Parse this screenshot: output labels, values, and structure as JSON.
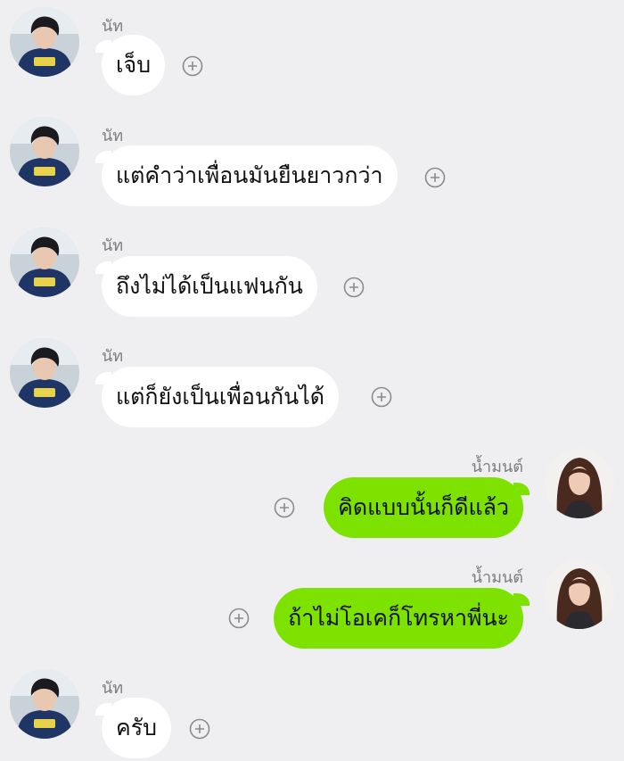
{
  "chat": {
    "messages": [
      {
        "sender": "นัท",
        "direction": "incoming",
        "text": "เจ็บ"
      },
      {
        "sender": "นัท",
        "direction": "incoming",
        "text": "แต่คำว่าเพื่อนมันยืนยาวกว่า"
      },
      {
        "sender": "นัท",
        "direction": "incoming",
        "text": "ถึงไม่ได้เป็นแฟนกัน"
      },
      {
        "sender": "นัท",
        "direction": "incoming",
        "text": "แต่ก็ยังเป็นเพื่อนกันได้"
      },
      {
        "sender": "น้ำมนต์",
        "direction": "outgoing",
        "text": "คิดแบบนั้นก็ดีแล้ว"
      },
      {
        "sender": "น้ำมนต์",
        "direction": "outgoing",
        "text": "ถ้าไม่โอเคก็โทรหาพี่นะ"
      },
      {
        "sender": "นัท",
        "direction": "incoming",
        "text": "ครับ"
      }
    ]
  },
  "icons": {
    "react": "plus-circle-icon",
    "avatar_incoming": "boy-hoodie-avatar",
    "avatar_outgoing": "girl-long-hair-avatar"
  },
  "colors": {
    "background": "#efeff1",
    "incoming_bubble": "#ffffff",
    "outgoing_bubble": "#7ee200",
    "sender_name": "#7d7d82",
    "icon": "#8a8a8f"
  }
}
